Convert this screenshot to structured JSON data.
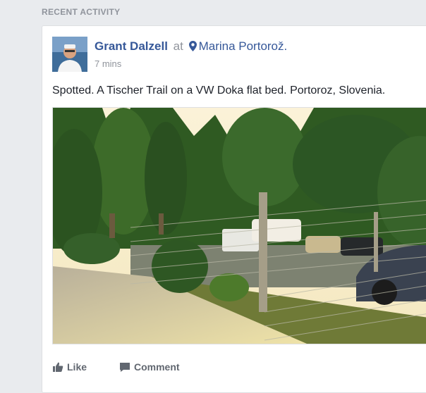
{
  "section": {
    "title": "RECENT ACTIVITY"
  },
  "post": {
    "author": "Grant Dalzell",
    "at_word": "at",
    "place": "Marina Portorož.",
    "time": "7 mins",
    "text": "Spotted. A Tischer Trail on a VW Doka flat bed. Portoroz, Slovenia.",
    "photo_icon": "photo-image",
    "avatar_icon": "user-avatar"
  },
  "actions": {
    "like_label": "Like",
    "comment_label": "Comment",
    "like_icon": "thumbs-up-icon",
    "comment_icon": "comment-bubble-icon"
  },
  "colors": {
    "link": "#365899",
    "muted": "#90949c",
    "background": "#e9ebee"
  }
}
